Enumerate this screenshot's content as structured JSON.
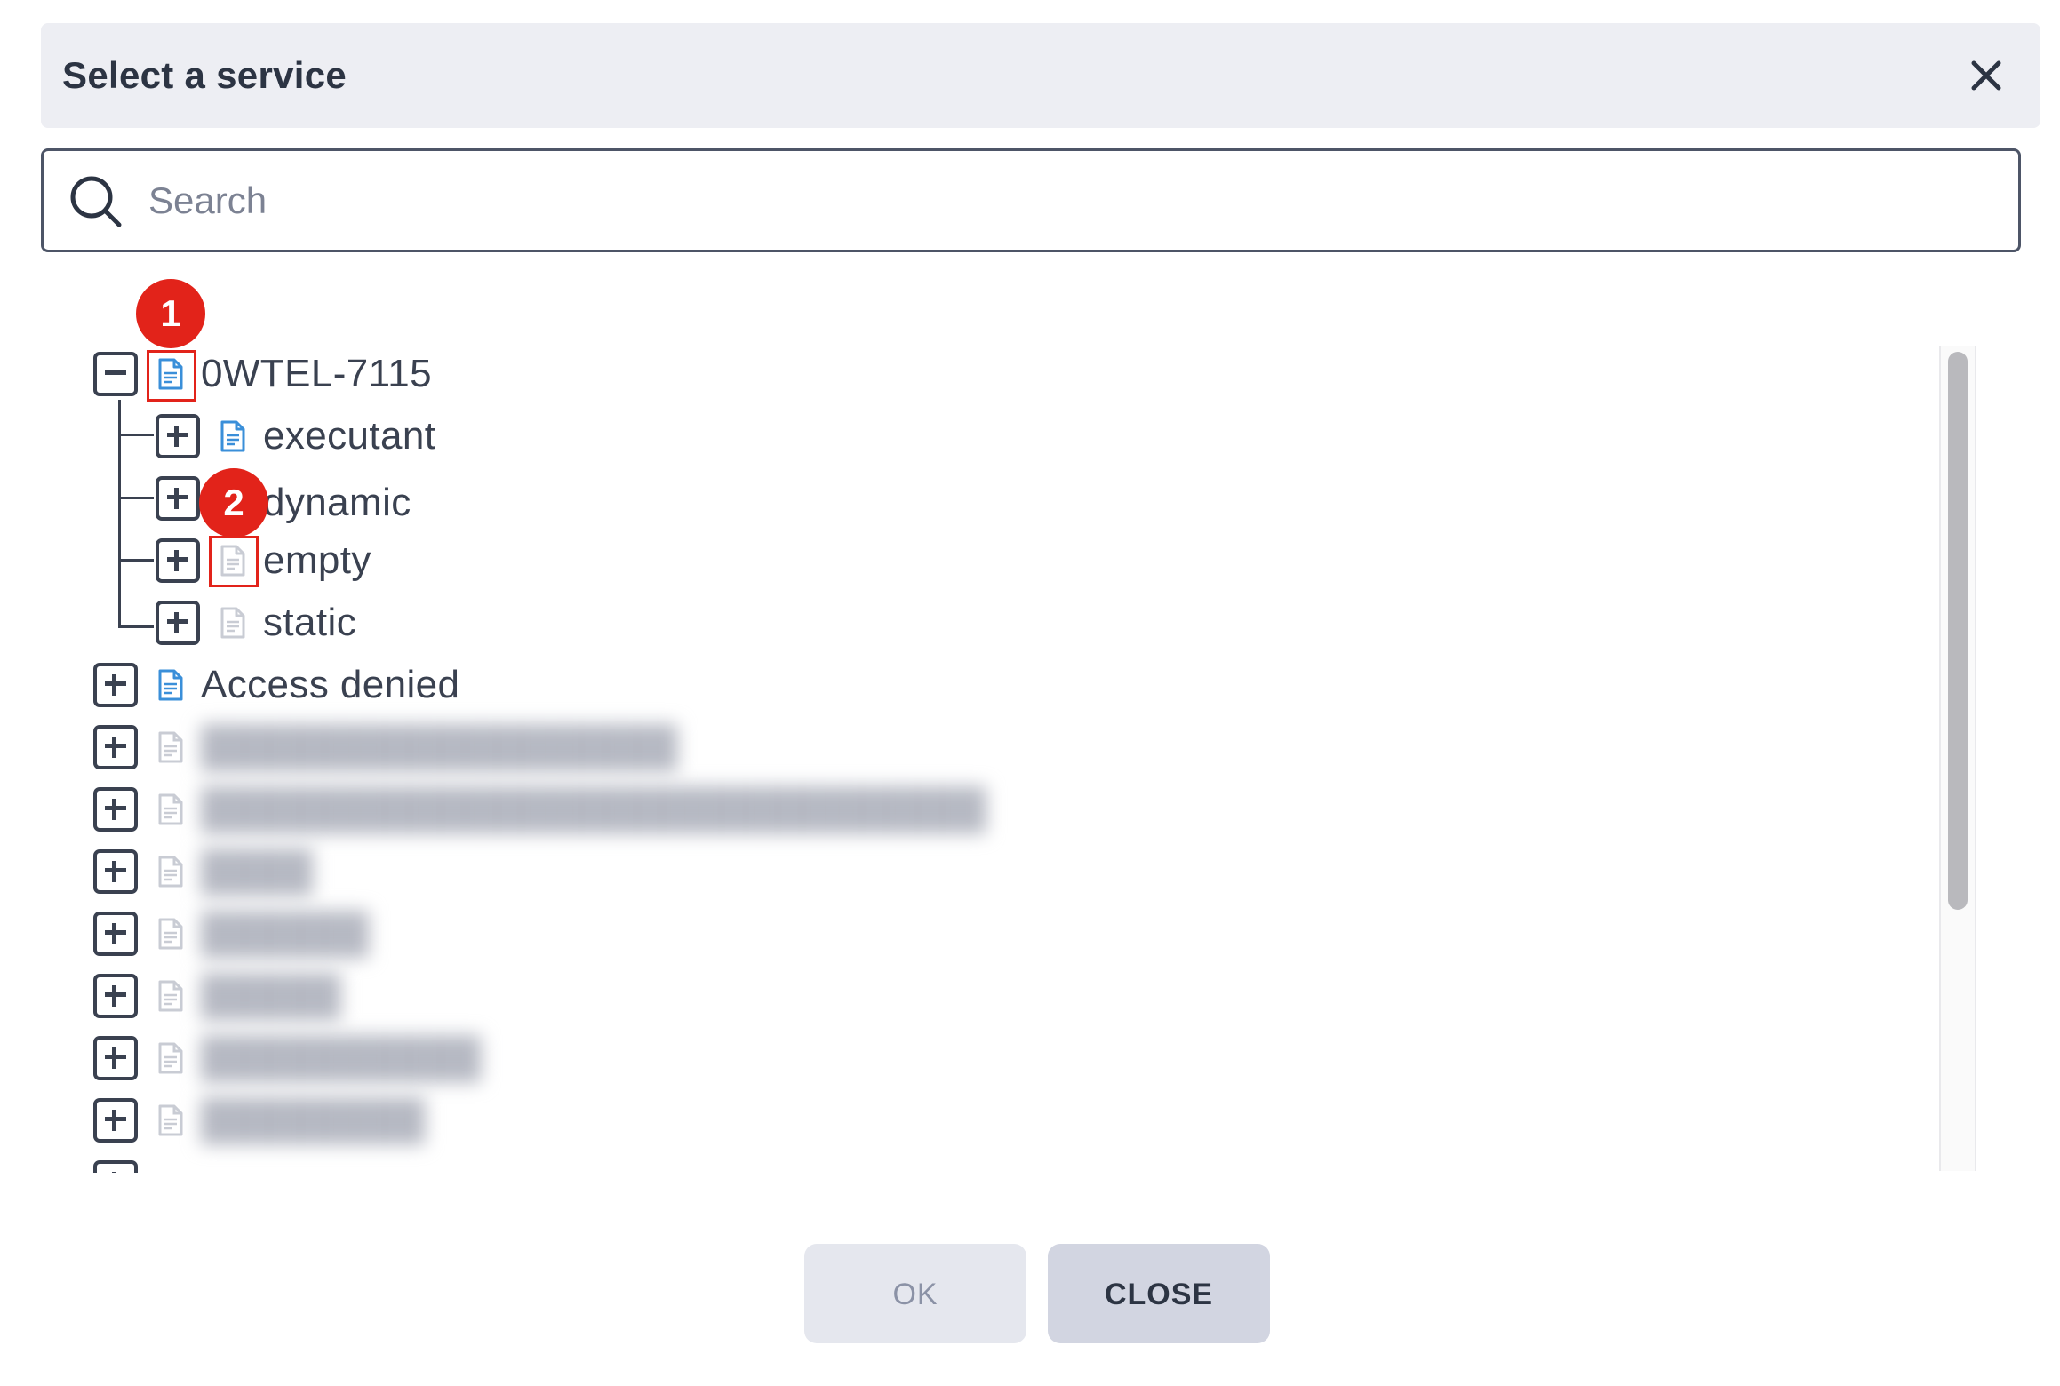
{
  "dialog": {
    "title": "Select a service",
    "close_icon": "close-icon"
  },
  "search": {
    "placeholder": "Search",
    "value": "",
    "icon": "search-icon"
  },
  "tree": {
    "root": {
      "label": "0WTEL-7115",
      "expanded": true,
      "icon_color": "#3a8fd9",
      "children": [
        {
          "label": "executant",
          "icon_color": "#3a8fd9"
        },
        {
          "label": "dynamic",
          "icon_color": "#c9ccd4"
        },
        {
          "label": "empty",
          "icon_color": "#c9ccd4"
        },
        {
          "label": "static",
          "icon_color": "#c9ccd4"
        }
      ]
    },
    "access_denied": {
      "label": "Access denied",
      "icon_color": "#3a8fd9"
    },
    "blurred_items": [
      "█████████████████",
      "████████████████████████████",
      "████",
      "██████",
      "█████",
      "██████████",
      "████████"
    ]
  },
  "annotations": [
    {
      "number": "1",
      "color": "#e2231a"
    },
    {
      "number": "2",
      "color": "#e2231a"
    }
  ],
  "footer": {
    "ok_label": "OK",
    "close_label": "CLOSE"
  }
}
